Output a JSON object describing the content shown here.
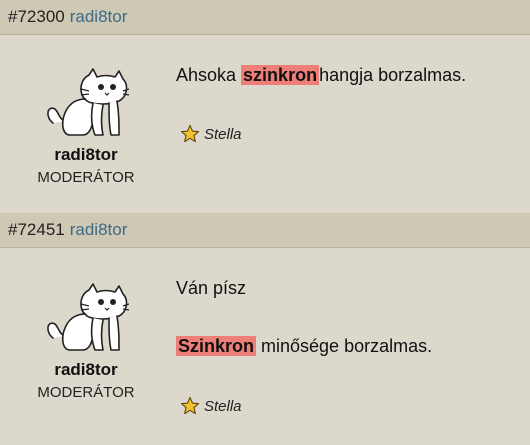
{
  "posts": [
    {
      "id": "#72300",
      "author": "radi8tor",
      "username": "radi8tor",
      "role": "MODERÁTOR",
      "lines": [
        {
          "before": "Ahsoka ",
          "highlight": "szinkron",
          "after": "hangja borzalmas."
        }
      ],
      "reaction_user": "Stella"
    },
    {
      "id": "#72451",
      "author": "radi8tor",
      "username": "radi8tor",
      "role": "MODERÁTOR",
      "lines": [
        {
          "text": "Ván písz"
        },
        {
          "highlight": "Szinkron",
          "after": " minősége borzalmas."
        }
      ],
      "reaction_user": "Stella"
    }
  ],
  "icons": {
    "avatar": "simons-cat-avatar",
    "reaction": "star-icon"
  },
  "colors": {
    "header_bg": "#cec8b5",
    "body_bg": "#ddd8cc",
    "author_link": "#3d6b86",
    "highlight": "#ee7f78",
    "star": "#f2c230"
  }
}
